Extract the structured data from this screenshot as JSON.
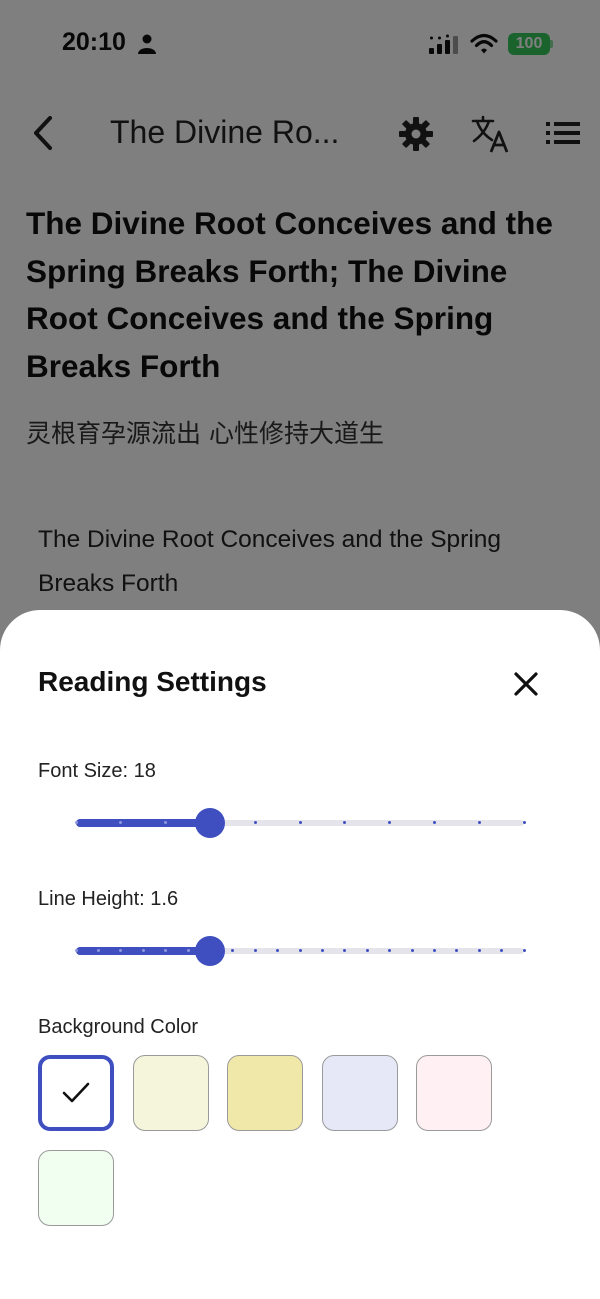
{
  "status_bar": {
    "time": "20:10",
    "battery": "100",
    "icons": [
      "person-icon",
      "signal-icon",
      "wifi-icon",
      "battery-icon"
    ]
  },
  "app_bar": {
    "title": "The Divine Ro...",
    "icons": [
      "back-icon",
      "gear-icon",
      "translate-icon",
      "table-of-contents-icon"
    ]
  },
  "chapter": {
    "title": "The Divine Root Conceives and the Spring Breaks Forth; The Divine Root Conceives and the Spring Breaks Forth",
    "subtitle": "灵根育孕源流出 心性修持大道生",
    "body": "The Divine Root Conceives and the Spring Breaks Forth"
  },
  "reading_settings": {
    "title": "Reading Settings",
    "close_icon": "close-icon",
    "font_size": {
      "label": "Font Size: 18",
      "value": 18,
      "steps": 11,
      "selected_index": 3
    },
    "line_height": {
      "label": "Line Height: 1.6",
      "value": 1.6,
      "steps": 21,
      "selected_index": 6
    },
    "background_color": {
      "label": "Background Color",
      "swatches": [
        {
          "color": "#ffffff",
          "selected": true
        },
        {
          "color": "#f5f5dc",
          "selected": false
        },
        {
          "color": "#f0e8a8",
          "selected": false
        },
        {
          "color": "#e6e8f8",
          "selected": false
        },
        {
          "color": "#fff0f4",
          "selected": false
        },
        {
          "color": "#f0fff0",
          "selected": false
        }
      ]
    }
  },
  "colors": {
    "accent": "#3f4fc0",
    "scrim": "rgba(0,0,0,0.5)",
    "battery": "#34c759"
  }
}
